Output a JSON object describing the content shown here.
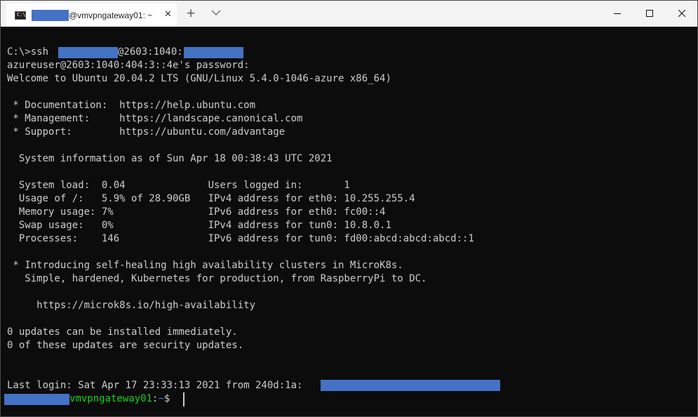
{
  "window": {
    "tab_prompt_glyph": "C:\\",
    "tab_title": "@vmvpngateway01: ~",
    "tab_close": "✕",
    "new_tab": "+",
    "controls": {
      "minimize": "minimize-icon",
      "maximize": "maximize-icon",
      "close": "close-icon"
    }
  },
  "terminal": {
    "lines": [
      "C:\\>ssh ",
      "@2603:1040:",
      "azureuser@2603:1040:404:3::4e's password:",
      "Welcome to Ubuntu 20.04.2 LTS (GNU/Linux 5.4.0-1046-azure x86_64)",
      " * Documentation:  https://help.ubuntu.com",
      " * Management:     https://landscape.canonical.com",
      " * Support:        https://ubuntu.com/advantage",
      "  System information as of Sun Apr 18 00:38:43 UTC 2021",
      "  System load:  0.04              Users logged in:       1",
      "  Usage of /:   5.9% of 28.90GB   IPv4 address for eth0: 10.255.255.4",
      "  Memory usage: 7%                IPv6 address for eth0: fc00::4",
      "  Swap usage:   0%                IPv4 address for tun0: 10.8.0.1",
      "  Processes:    146               IPv6 address for tun0: fd00:abcd:abcd:abcd::1",
      " * Introducing self-healing high availability clusters in MicroK8s.",
      "   Simple, hardened, Kubernetes for production, from RaspberryPi to DC.",
      "     https://microk8s.io/high-availability",
      "0 updates can be installed immediately.",
      "0 of these updates are security updates.",
      "Last login: Sat Apr 17 23:33:13 2021 from 240d:1a:"
    ],
    "prompt": {
      "host": "vmvpngateway01",
      "separator": ":",
      "path": "~",
      "symbol": "$ "
    }
  },
  "colors": {
    "background": "#0c0c0c",
    "foreground": "#cccccc",
    "prompt_host": "#13d313",
    "prompt_path": "#3b78ff",
    "redaction": "#4472c4"
  }
}
